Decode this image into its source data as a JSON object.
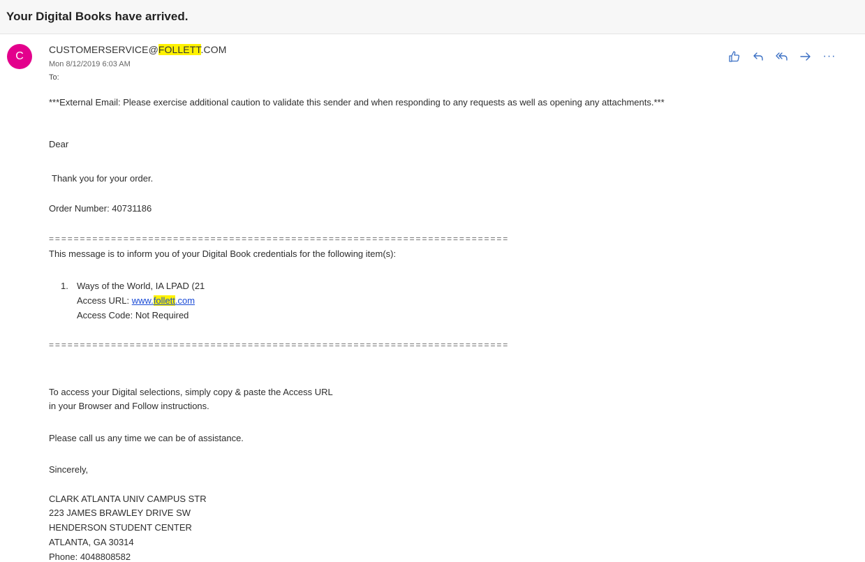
{
  "email": {
    "subject": "Your Digital Books have arrived.",
    "avatar_initial": "C",
    "sender_prefix": "CUSTOMERSERVICE@",
    "sender_highlight": "FOLLETT",
    "sender_suffix": ".COM",
    "date": "Mon 8/12/2019 6:03 AM",
    "to_label": "To:"
  },
  "actions": [
    {
      "name": "like",
      "icon": "thumbs-up-icon"
    },
    {
      "name": "reply",
      "icon": "reply-icon"
    },
    {
      "name": "reply-all",
      "icon": "reply-all-icon"
    },
    {
      "name": "forward",
      "icon": "forward-icon"
    },
    {
      "name": "more",
      "icon": "more-icon",
      "label": "···"
    }
  ],
  "colors": {
    "avatar": "#e3008c",
    "highlight": "#fff200",
    "action_icon": "#3a6fc4",
    "link": "#1a4bd6"
  },
  "body": {
    "warning": "***External Email: Please exercise additional caution to validate this sender and when responding to any requests as well as opening any attachments.***",
    "greeting": "Dear",
    "thanks": "Thank you for your order.",
    "order_number": "Order Number: 40731186",
    "separator": "==========================================================================",
    "intro": "This message is to inform you of your Digital Book credentials for the following item(s):",
    "item": {
      "number": "1.",
      "title": "Ways of the World, IA LPAD (21",
      "url_label": "Access URL: ",
      "url_prefix": "www.",
      "url_highlight": "follett",
      "url_suffix": ".com",
      "code": "Access Code: Not Required"
    },
    "instructions_1": "To access your Digital selections, simply copy & paste the Access URL",
    "instructions_2": "in your  Browser and Follow instructions.",
    "assist": "Please call us any time we can be of assistance.",
    "closing": "Sincerely,",
    "address": [
      "CLARK ATLANTA UNIV CAMPUS STR",
      "223 JAMES BRAWLEY DRIVE SW",
      "HENDERSON STUDENT CENTER",
      "ATLANTA, GA    30314",
      "Phone: 4048808582"
    ]
  }
}
